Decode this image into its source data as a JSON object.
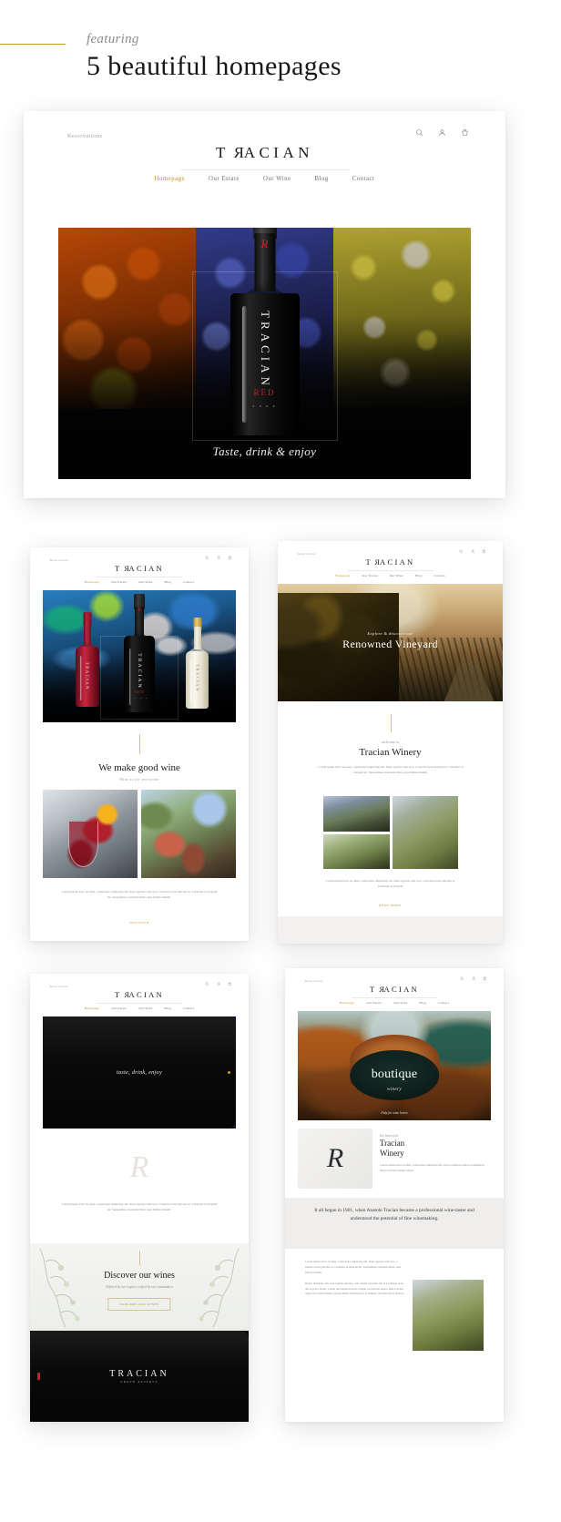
{
  "header": {
    "featuring": "featuring",
    "title": "5 beautiful homepages",
    "rule_color": "#c09a34"
  },
  "brand": {
    "name": "TRACIAN",
    "accent_color": "#bd8c2b"
  },
  "site_chrome": {
    "reservations_label": "Reservations",
    "icons": [
      "search-icon",
      "account-icon",
      "cart-icon"
    ],
    "nav": [
      {
        "label": "Homepage",
        "active": true
      },
      {
        "label": "Our Estate",
        "active": false
      },
      {
        "label": "Our Wine",
        "active": false
      },
      {
        "label": "Blog",
        "active": false
      },
      {
        "label": "Contact",
        "active": false
      }
    ]
  },
  "mockups": [
    {
      "id": "homepage-hero",
      "hero": {
        "bottle_label": "TRACIAN",
        "bottle_sub": "RED",
        "bottle_dots": "● ● ● ●",
        "tagline": "Taste, drink & enjoy"
      }
    },
    {
      "id": "homepage-good-wine",
      "bottles": [
        {
          "label": "TRACIAN",
          "variant": "rose"
        },
        {
          "label": "TRACIAN",
          "variant": "red",
          "sub": "RED",
          "dots": "● ● ● ●"
        },
        {
          "label": "TRACIAN",
          "variant": "white"
        }
      ],
      "heading": "We make good wine",
      "subheading": "Wine is for everyone",
      "body": "Lorem ipsum dolor sit amet, consectetur adipiscing elit. Nunc egestas velit eros, a lobortis lacus pulvinar et. Curabitur ut aliquam mi. Suspendisse venenatis libero quis finibus blandit.",
      "cta": "DISCOVER"
    },
    {
      "id": "homepage-vineyard",
      "hero": {
        "eyebrow": "Explore & discover our",
        "heading": "Renowned Vineyard"
      },
      "welcome": "welcome to",
      "heading": "Tracian Winery",
      "body": "Lorem ipsum dolor sit amet, consectetur adipiscing elit. Nunc egestas velit eros, a lobortis lacus pulvinar et. Curabitur ut aliquam mi. Suspendisse venenatis libero quis finibus blandit.",
      "body2": "Lorem ipsum dolor sit amet, consectetur adipiscing elit. Nunc egestas velit eros, a lobortis lacus pulvinar et. Curabitur ut aliquam.",
      "cta": "READ MORE"
    },
    {
      "id": "homepage-discover",
      "hero_bottle_label": "taste, drink, enjoy",
      "monogram": "R",
      "body": "Lorem ipsum dolor sit amet, consectetur adipiscing elit. Nunc egestas velit eros, a lobortis lacus pulvinar et. Curabitur ut aliquam mi. Suspendisse venenatis libero quis finibus blandit.",
      "band_heading": "Discover our wines",
      "band_subheading": "Defined by our region, crafted by our winemakers",
      "band_button": "EXPLORE OUR WINES",
      "bottle_label": "TRACIAN",
      "bottle_sub": "GRAND RESERVE"
    },
    {
      "id": "homepage-boutique",
      "hero": {
        "heading": "boutique",
        "subheading": "winery",
        "note": "Only for wine lovers"
      },
      "monogram": "R",
      "mid_eyebrow": "the historical",
      "mid_heading": "Tracian\nWinery",
      "mid_body": "Lorem ipsum dolor sit amet, consectetur adipiscing elit, sed do eiusmod tempor incididunt ut labore et dolore magna aliqua.",
      "band_text": "It all began in 1901, when Anatole Tracian became a professional wine-taster and understood the potential of fine winemaking.",
      "lower_body1": "Lorem ipsum dolor sit amet, consectetur adipiscing elit. Nunc egestas velit eros, a lobortis lacus pulvinar et. Curabitur ut aliquam mi. Suspendisse venenatis libero quis finibus blandit.",
      "lower_body2": "Donec interdum, ante non sagittis pulvinar, odio sapien convallis mi, at accumsan lacus dui eu justo. Donec a nulla non neque rhoncus congue, eu placerat neque. Duis facilisis augue nec lorem rutrum, egestas mattis maximus leo et tempus convallis nisl ut ultrices."
    }
  ]
}
